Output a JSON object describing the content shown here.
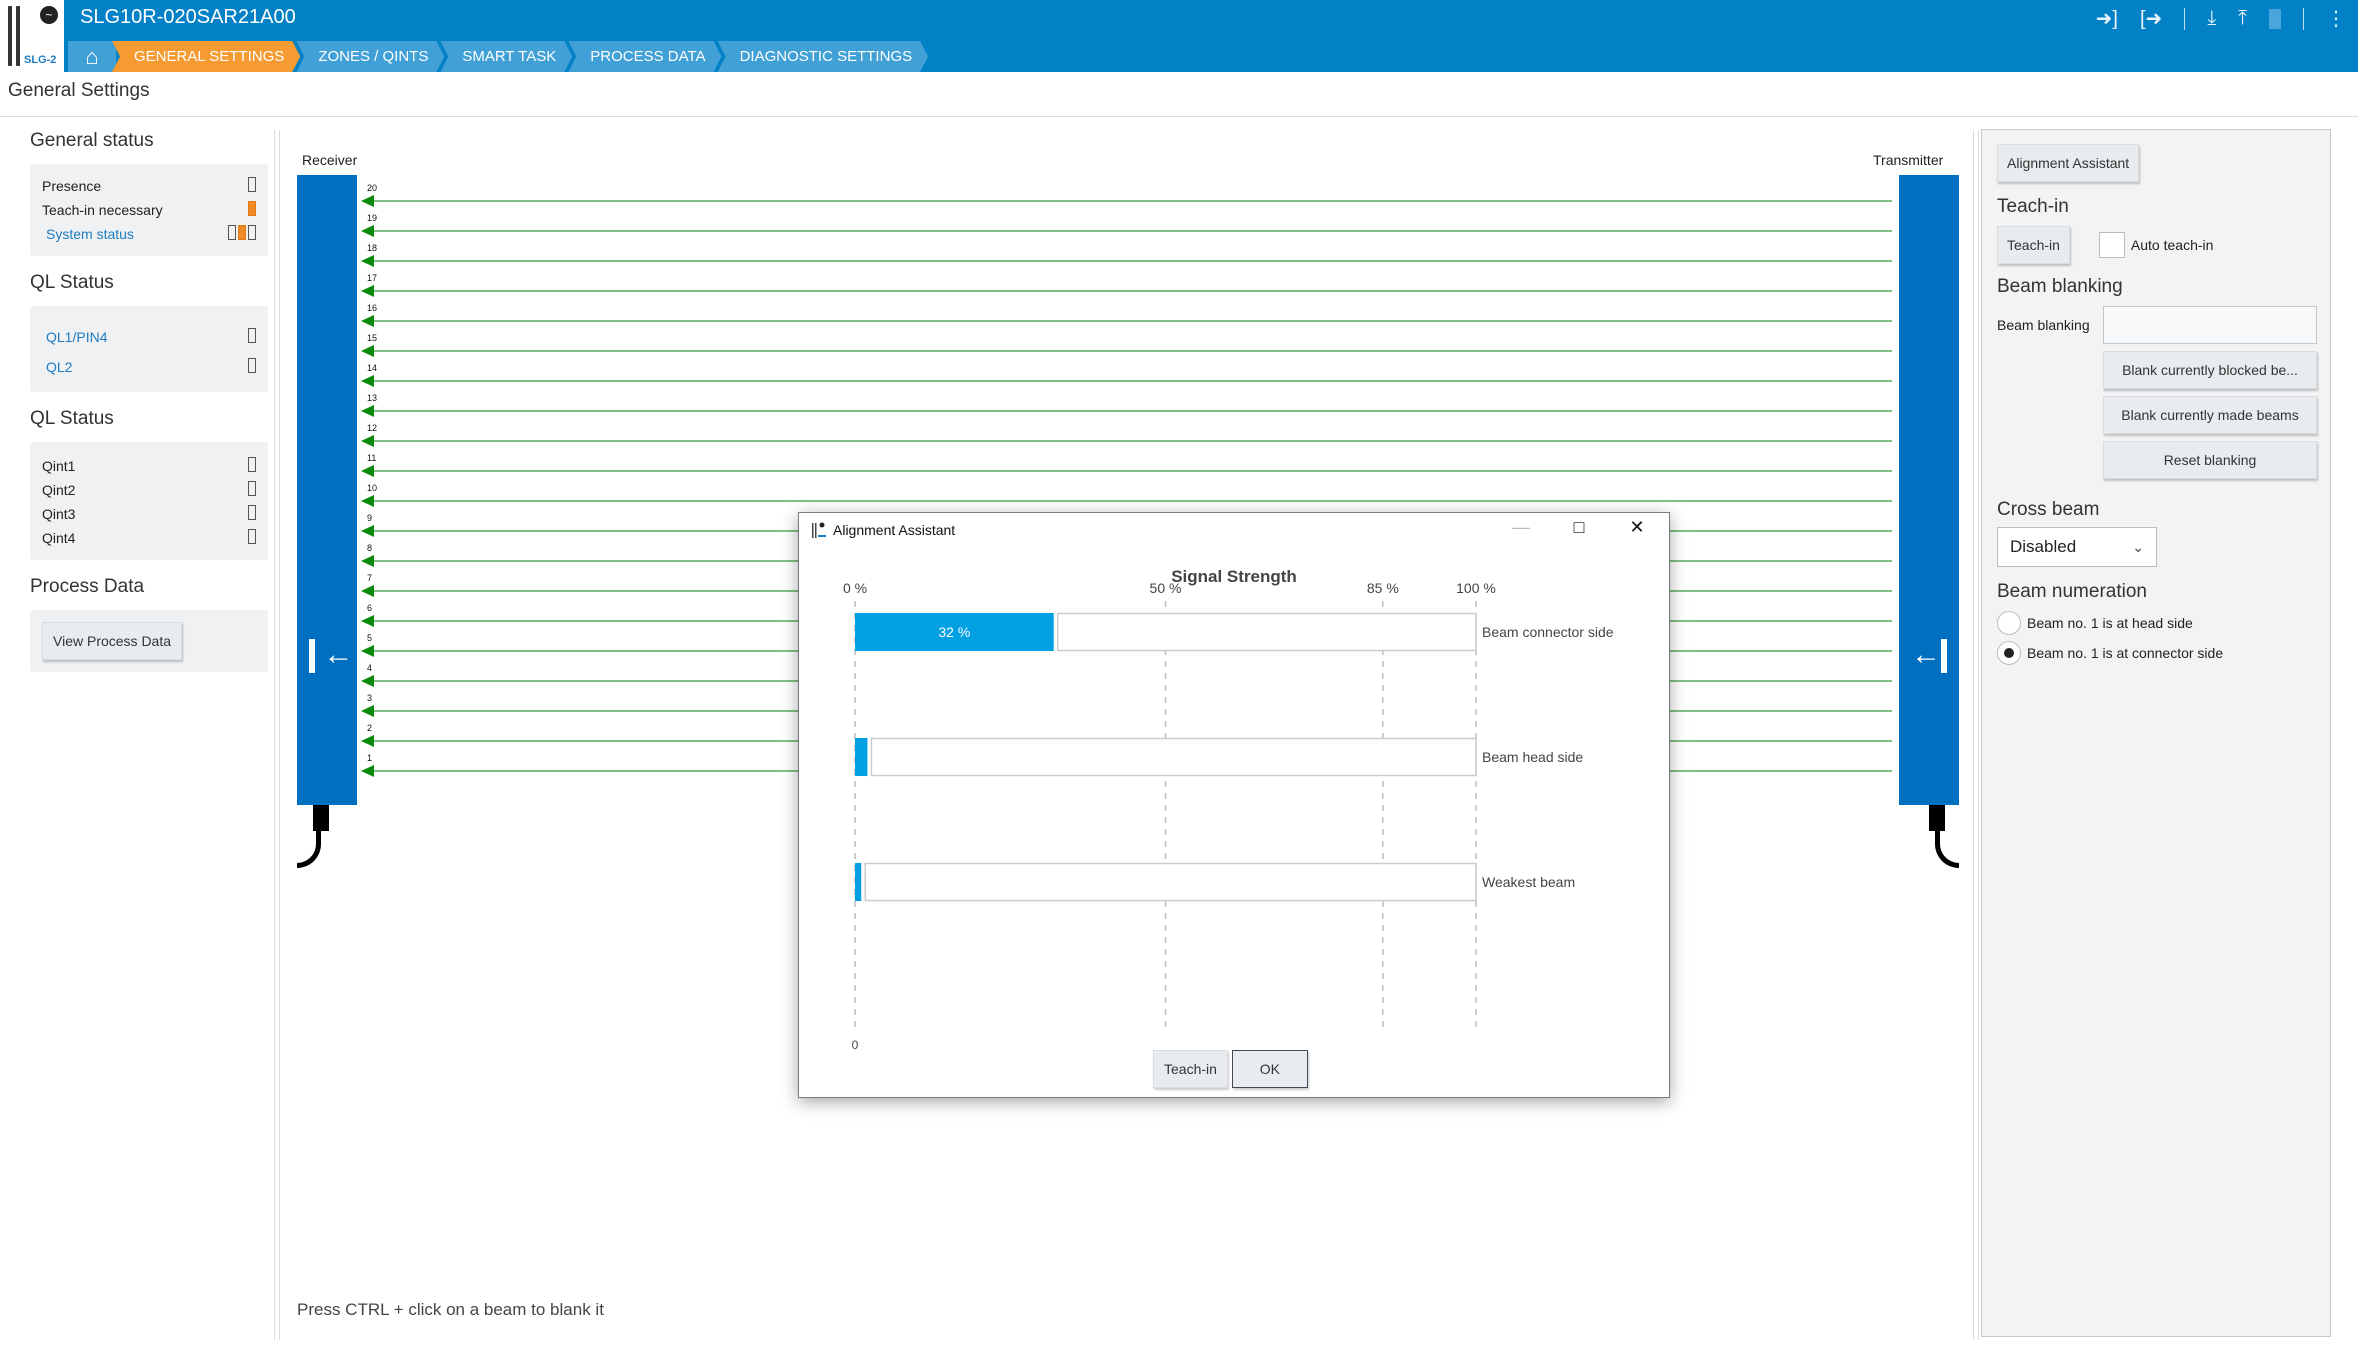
{
  "header": {
    "logo_brand": "SLG-2",
    "title": "SLG10R-020SAR21A00",
    "nav": [
      {
        "label": "GENERAL SETTINGS",
        "active": true
      },
      {
        "label": "ZONES / QINTS",
        "active": false
      },
      {
        "label": "SMART TASK",
        "active": false
      },
      {
        "label": "PROCESS DATA",
        "active": false
      },
      {
        "label": "DIAGNOSTIC SETTINGS",
        "active": false
      }
    ],
    "icons": [
      "login-icon",
      "logout-icon",
      "download-icon",
      "upload-icon",
      "device-icon",
      "more-icon"
    ]
  },
  "page_title": "General Settings",
  "left_panel": {
    "general_status": {
      "title": "General status",
      "items": [
        {
          "label": "Presence",
          "leds": [
            "off"
          ]
        },
        {
          "label": "Teach-in necessary",
          "leds": [
            "on"
          ]
        },
        {
          "label": "System status",
          "link": true,
          "leds": [
            "off",
            "on",
            "off"
          ]
        }
      ]
    },
    "ql_status": {
      "title": "QL Status",
      "items": [
        {
          "label": "QL1/PIN4",
          "link": true,
          "leds": [
            "off"
          ]
        },
        {
          "label": "QL2",
          "link": true,
          "leds": [
            "off"
          ]
        }
      ]
    },
    "qint_status": {
      "title": "QL Status",
      "items": [
        {
          "label": "Qint1",
          "leds": [
            "off"
          ]
        },
        {
          "label": "Qint2",
          "leds": [
            "off"
          ]
        },
        {
          "label": "Qint3",
          "leds": [
            "off"
          ]
        },
        {
          "label": "Qint4",
          "leds": [
            "off"
          ]
        }
      ]
    },
    "process_data": {
      "title": "Process Data",
      "button": "View Process Data"
    }
  },
  "beam_view": {
    "receiver_label": "Receiver",
    "transmitter_label": "Transmitter",
    "beam_count": 20,
    "beam_color": "#7fc082",
    "arrow_color": "#0a8a0a",
    "hint": "Press CTRL + click on a beam to blank it"
  },
  "right_panel": {
    "alignment_button": "Alignment Assistant",
    "teach_in": {
      "title": "Teach-in",
      "button": "Teach-in",
      "auto_label": "Auto teach-in",
      "auto_checked": false
    },
    "beam_blanking": {
      "title": "Beam blanking",
      "field_label": "Beam blanking",
      "field_value": "",
      "buttons": [
        "Blank currently blocked be...",
        "Blank currently made beams",
        "Reset blanking"
      ]
    },
    "cross_beam": {
      "title": "Cross beam",
      "value": "Disabled"
    },
    "beam_numeration": {
      "title": "Beam numeration",
      "options": [
        {
          "label": "Beam no. 1 is at head side",
          "selected": false
        },
        {
          "label": "Beam no. 1 is at connector side",
          "selected": true
        }
      ]
    }
  },
  "dialog": {
    "title": "Alignment Assistant",
    "buttons": {
      "teach_in": "Teach-in",
      "ok": "OK"
    }
  },
  "chart_data": {
    "type": "bar",
    "orientation": "horizontal",
    "title": "Signal Strength",
    "categories": [
      "Beam connector side",
      "Beam head side",
      "Weakest beam"
    ],
    "values": [
      32,
      2,
      1
    ],
    "value_labels": [
      "32 %",
      "",
      ""
    ],
    "xlim": [
      0,
      100
    ],
    "ticks": [
      0,
      50,
      85,
      100
    ],
    "tick_labels": [
      "0 %",
      "50 %",
      "85 %",
      "100 %"
    ],
    "bottom_label": "0",
    "grid": "dashed vertical at ticks",
    "bar_color": "#00a0e3"
  }
}
